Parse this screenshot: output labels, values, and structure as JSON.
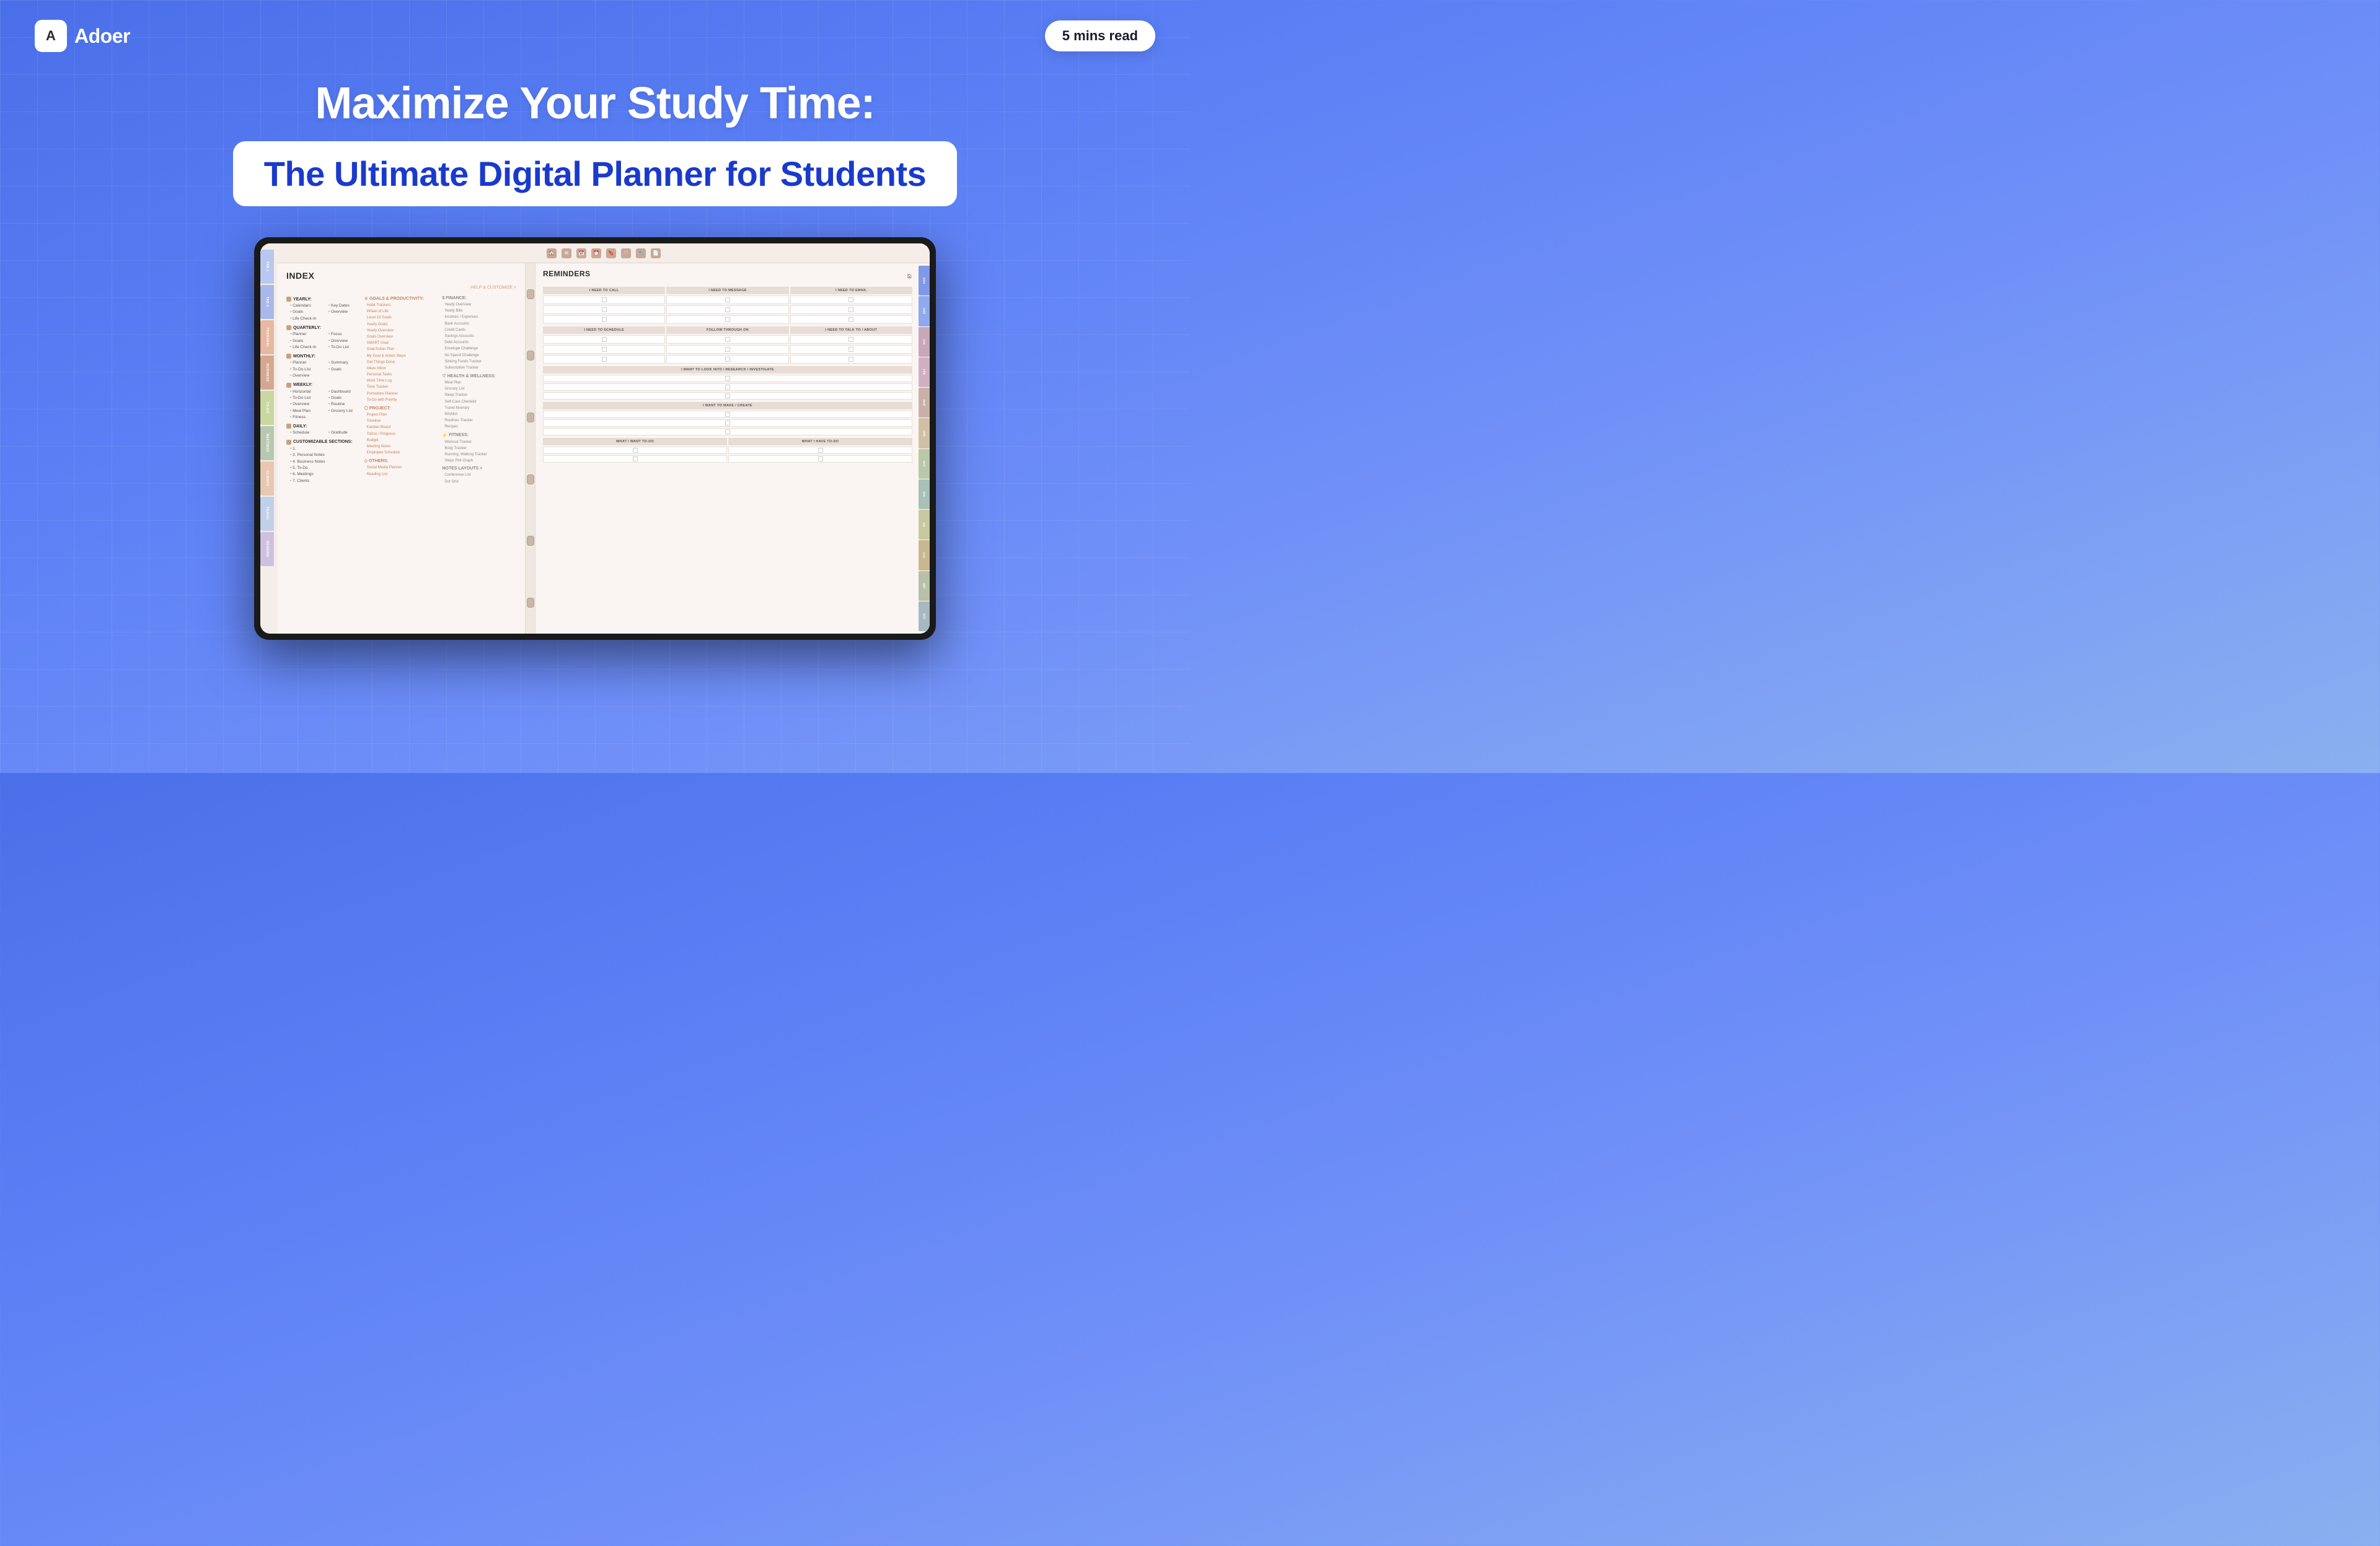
{
  "header": {
    "logo_letter": "A",
    "logo_name": "Adoer",
    "read_time": "5 mins read"
  },
  "hero": {
    "title_main": "Maximize Your Study Time:",
    "subtitle": "The Ultimate Digital Planner for Students"
  },
  "planner": {
    "index_title": "INDEX",
    "help_link": "HELP & CUSTOMIZE >",
    "reminders_title": "REMINDERS",
    "yearly_section": "YEARLY:",
    "yearly_items": [
      "Calendars",
      "Goals",
      "Life Check-In"
    ],
    "yearly_right": [
      "Key Dates",
      "Overview"
    ],
    "quarterly_section": "QUARTERLY:",
    "quarterly_items": [
      "Planner",
      "Goals",
      "Life Check-In"
    ],
    "quarterly_right": [
      "Focus",
      "Overview",
      "To-Do List"
    ],
    "monthly_section": "MONTHLY:",
    "monthly_items": [
      "Planner",
      "To-Do List",
      "Overview"
    ],
    "monthly_right": [
      "Summary",
      "Goals"
    ],
    "weekly_section": "WEEKLY:",
    "weekly_items": [
      "Horizontal",
      "To-Do List",
      "Overview",
      "Meal Plan",
      "Fitness"
    ],
    "weekly_right": [
      "Dashboard",
      "Goals",
      "Routine",
      "Grocery List"
    ],
    "daily_section": "DAILY:",
    "daily_items": [
      "Schedule"
    ],
    "daily_right": [
      "Gratitude"
    ],
    "customizable": "CUSTOMIZABLE SECTIONS:",
    "custom_items": [
      "1.",
      "3. Personal Notes",
      "4. Business Notes",
      "5. To-Do",
      "6. Meetings",
      "7. Clients"
    ],
    "goals_section": "GOALS & PRODUCTIVITY:",
    "goals_items": [
      "Habit Trackers",
      "Wheel of Life",
      "Level 10 Goals",
      "Yearly Goals",
      "Yearly Overview",
      "Goals Overview",
      "SMART Goal",
      "Goal Action Plan",
      "My Goal & Action Steps",
      "Get Things Done",
      "Ideas Inbox",
      "Personal Tasks",
      "Work Time Log",
      "Time Tracker",
      "Pomodoro Planner",
      "To-Do with Priority"
    ],
    "project_section": "PROJECT:",
    "project_items": [
      "Project Plan",
      "Timeline",
      "Kanban Board",
      "ToDos / Progress",
      "Budget",
      "Meeting Notes",
      "Employee Schedule"
    ],
    "others_section": "OTHERS:",
    "others_items": [
      "Social Media Planner",
      "Reading List"
    ],
    "finance_section": "FINANCE:",
    "finance_items": [
      "Yearly Overview",
      "Yearly Bills",
      "Incomes / Expenses",
      "Bank Accounts",
      "Credit Cards",
      "Savings Accounts",
      "Debt Accounts",
      "Envelope Challenge",
      "No Spend Challenge",
      "Sinking Funds Tracker",
      "Subscription Tracker"
    ],
    "health_section": "HEALTH & WELLNESS:",
    "health_items": [
      "Meal Plan",
      "Grocery List",
      "Sleep Tracker",
      "Self-Care Checklist",
      "Travel Itinerary",
      "Wishlist",
      "Routines Tracker",
      "Recipes"
    ],
    "fitness_section": "FITNESS:",
    "fitness_items": [
      "Workout Tracker",
      "Body Tracker",
      "Running, Walking Tracker",
      "Steps Plot Graph"
    ],
    "notes_section": "NOTES LAYOUTS >",
    "notes_items": [
      "Conference List",
      "Dot Grid"
    ],
    "reminder_cols": [
      "I NEED TO CALL",
      "I NEED TO MESSAGE",
      "I NEED TO EMAIL"
    ],
    "reminder_cols2": [
      "I NEED TO SCHEDULE",
      "FOLLOW THROUGH ON",
      "I NEED TO TALK TO / ABOUT"
    ],
    "reminder_full1": "I WANT TO LOOK INTO / RESEARCH / INVESTIGATE",
    "reminder_full2": "I WANT TO MAKE / CREATE",
    "reminder_cols3": [
      "WHAT I WANT TO-DO",
      "WHAT I HAVE TO-DO"
    ],
    "side_tabs": [
      "TAB 1",
      "TAB 2",
      "PERSONAL",
      "BUSINESS",
      "TO-DO",
      "MEETINGS",
      "CLIENTS",
      "TRAVEL",
      "READING"
    ],
    "side_tab_colors": [
      "#b8c8f0",
      "#a8b8e8",
      "#e8b8a0",
      "#d4a890",
      "#c8d8a0",
      "#b8c8b0",
      "#e8c8b0",
      "#c0d0e8",
      "#d0c0e0"
    ],
    "year_tabs": [
      "2024",
      "2025",
      "JAN",
      "FEB",
      "MAR",
      "APR",
      "MAY",
      "JUN",
      "JUL",
      "AUG",
      "SEP",
      "OCT"
    ],
    "year_tab_colors": [
      "#8098e8",
      "#90a8f0",
      "#c8a8b8",
      "#d0b0c0",
      "#c8b0a8",
      "#d0c0a8",
      "#b8c8a8",
      "#a8c0b8",
      "#c8c8a0",
      "#c8b890",
      "#b8c0a8",
      "#a8b8c0"
    ]
  }
}
